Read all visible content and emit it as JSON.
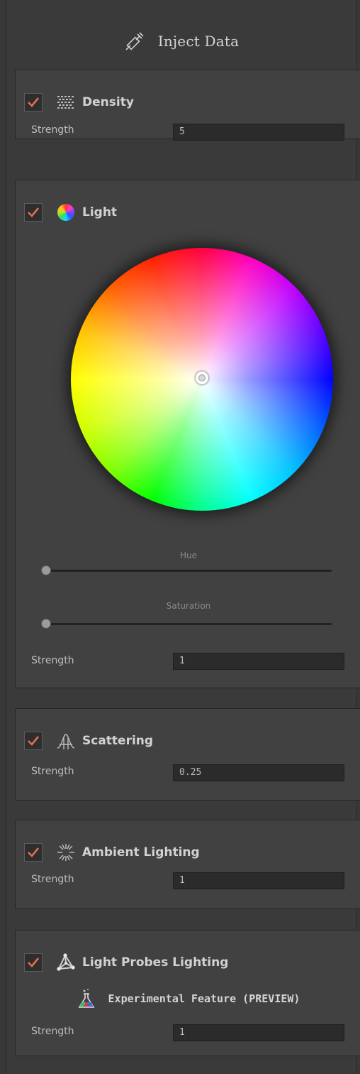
{
  "header": {
    "title": "Inject Data",
    "icon": "syringe-icon"
  },
  "sections": {
    "density": {
      "title": "Density",
      "checked": true,
      "strength_label": "Strength",
      "strength_value": "5",
      "icon": "density-dots-icon"
    },
    "light": {
      "title": "Light",
      "checked": true,
      "icon": "color-wheel-icon",
      "hue_label": "Hue",
      "hue_value": 0,
      "saturation_label": "Saturation",
      "saturation_value": 0,
      "strength_label": "Strength",
      "strength_value": "1"
    },
    "scattering": {
      "title": "Scattering",
      "checked": true,
      "strength_label": "Strength",
      "strength_value": "0.25",
      "icon": "scattering-curve-icon"
    },
    "ambient": {
      "title": "Ambient Lighting",
      "checked": true,
      "strength_label": "Strength",
      "strength_value": "1",
      "icon": "ambient-burst-icon"
    },
    "probes": {
      "title": "Light Probes Lighting",
      "checked": true,
      "icon": "light-probes-icon",
      "experimental_label": "Experimental Feature (PREVIEW)",
      "strength_label": "Strength",
      "strength_value": "1"
    }
  },
  "colors": {
    "check_accent": "#e0714d",
    "panel_bg": "#3a3a3a",
    "section_bg": "#414141"
  }
}
